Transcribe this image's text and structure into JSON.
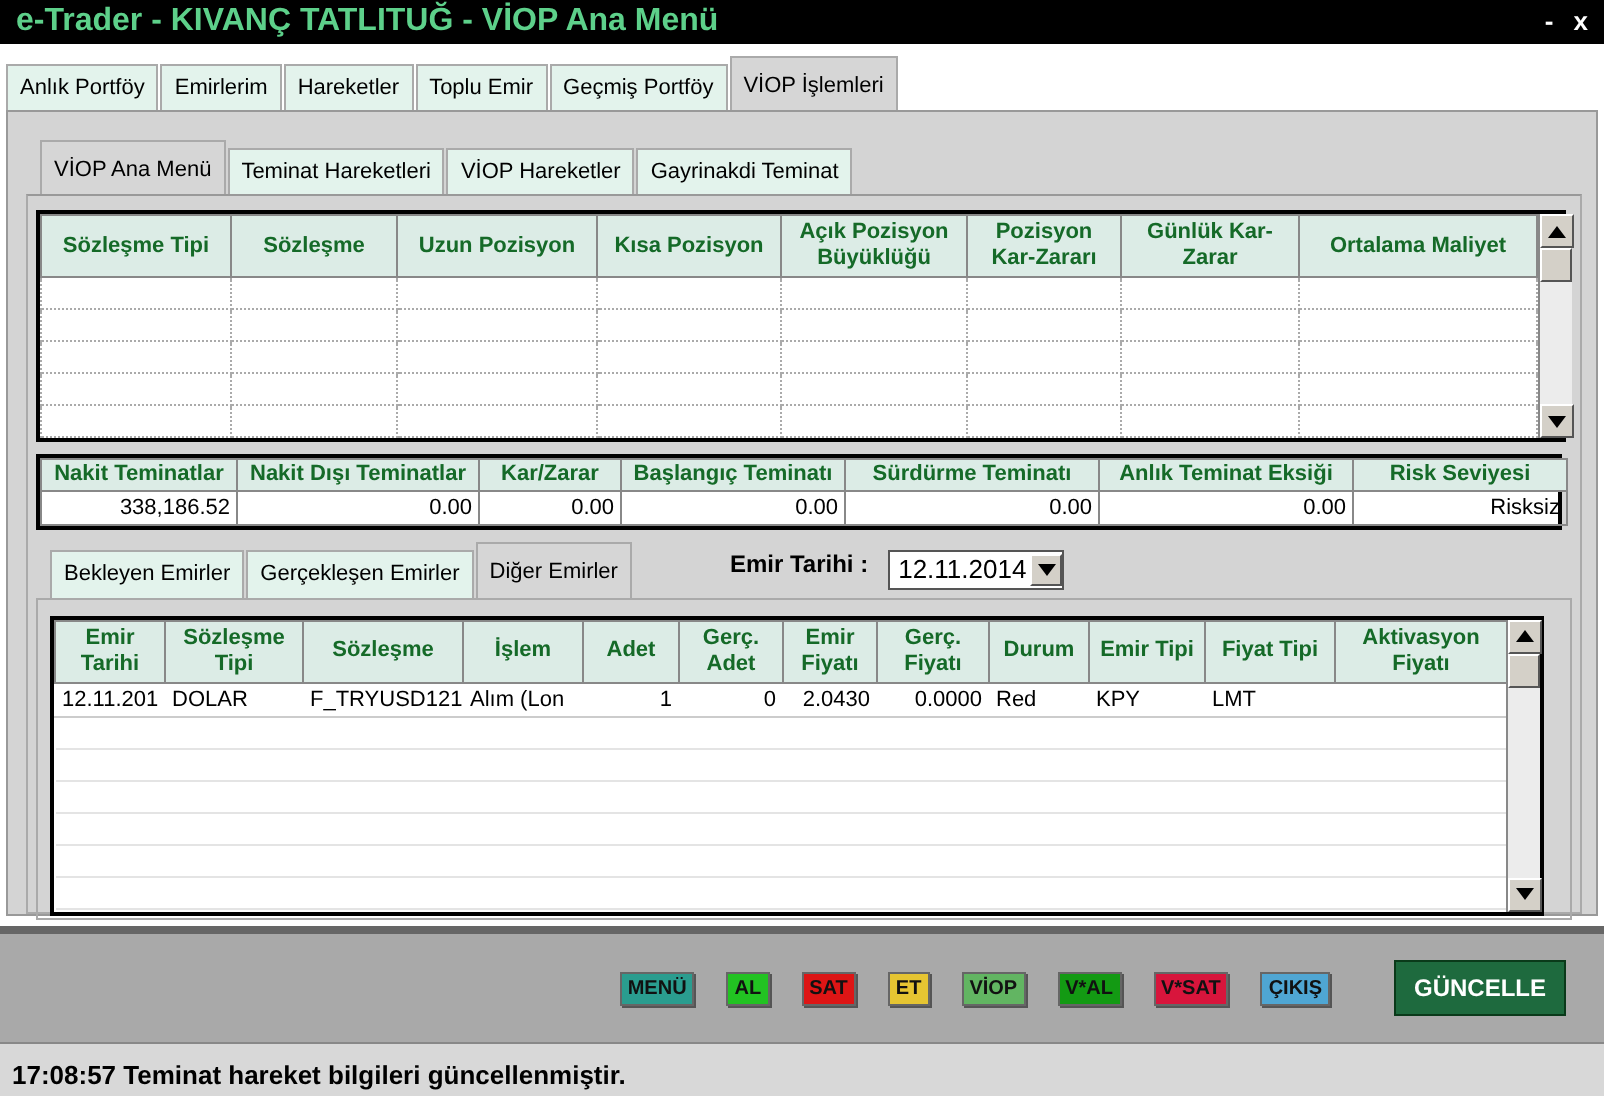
{
  "window": {
    "title": "e-Trader - KIVANÇ TATLITUĞ - VİOP Ana Menü",
    "controls": [
      "-",
      "x"
    ]
  },
  "tabs": [
    {
      "label": "Anlık Portföy",
      "selected": false
    },
    {
      "label": "Emirlerim",
      "selected": false
    },
    {
      "label": "Hareketler",
      "selected": false
    },
    {
      "label": "Toplu Emir",
      "selected": false
    },
    {
      "label": "Geçmiş Portföy",
      "selected": false
    },
    {
      "label": "VİOP İşlemleri",
      "selected": true
    }
  ],
  "subtabs": [
    {
      "label": "VİOP Ana Menü",
      "selected": true
    },
    {
      "label": "Teminat Hareketleri",
      "selected": false
    },
    {
      "label": "VİOP Hareketler",
      "selected": false
    },
    {
      "label": "Gayrinakdi Teminat",
      "selected": false
    }
  ],
  "positions": {
    "columns": [
      "Sözleşme Tipi",
      "Sözleşme",
      "Uzun Pozisyon",
      "Kısa Pozisyon",
      "Açık Pozisyon Büyüklüğü",
      "Pozisyon Kar-Zararı",
      "Günlük Kar-Zarar",
      "Ortalama Maliyet"
    ]
  },
  "summary": {
    "columns": [
      "Nakit Teminatlar",
      "Nakit Dışı Teminatlar",
      "Kar/Zarar",
      "Başlangıç Teminatı",
      "Sürdürme Teminatı",
      "Anlık Teminat Eksiği",
      "Risk Seviyesi"
    ],
    "row": [
      "338,186.52",
      "0.00",
      "0.00",
      "0.00",
      "0.00",
      "0.00",
      "Risksiz"
    ]
  },
  "order_tabs": [
    {
      "label": "Bekleyen Emirler",
      "selected": false
    },
    {
      "label": "Gerçekleşen Emirler",
      "selected": false
    },
    {
      "label": "Diğer Emirler",
      "selected": true
    }
  ],
  "order_date": {
    "label": "Emir Tarihi :",
    "value": "12.11.2014"
  },
  "orders": {
    "columns": [
      "Emir Tarihi",
      "Sözleşme Tipi",
      "Sözleşme",
      "İşlem",
      "Adet",
      "Gerç. Adet",
      "Emir Fiyatı",
      "Gerç. Fiyatı",
      "Durum",
      "Emir Tipi",
      "Fiyat Tipi",
      "Aktivasyon Fiyatı"
    ],
    "rows": [
      [
        "12.11.201",
        "DOLAR",
        "F_TRYUSD121",
        "Alım (Lon",
        "1",
        "0",
        "2.0430",
        "0.0000",
        "Red",
        "KPY",
        "LMT",
        ""
      ]
    ]
  },
  "toolbar": [
    {
      "label": "MENÜ",
      "color": "#2a9d8f"
    },
    {
      "label": "AL",
      "color": "#22c322"
    },
    {
      "label": "SAT",
      "color": "#dd1515"
    },
    {
      "label": "ET",
      "color": "#e6c532"
    },
    {
      "label": "VİOP",
      "color": "#62b562"
    },
    {
      "label": "V*AL",
      "color": "#139a13"
    },
    {
      "label": "V*SAT",
      "color": "#d8153c"
    },
    {
      "label": "ÇIKIŞ",
      "color": "#4fa6d3"
    }
  ],
  "update_button": "GÜNCELLE",
  "status_bar": "17:08:57 Teminat hareket bilgileri güncellenmiştir."
}
